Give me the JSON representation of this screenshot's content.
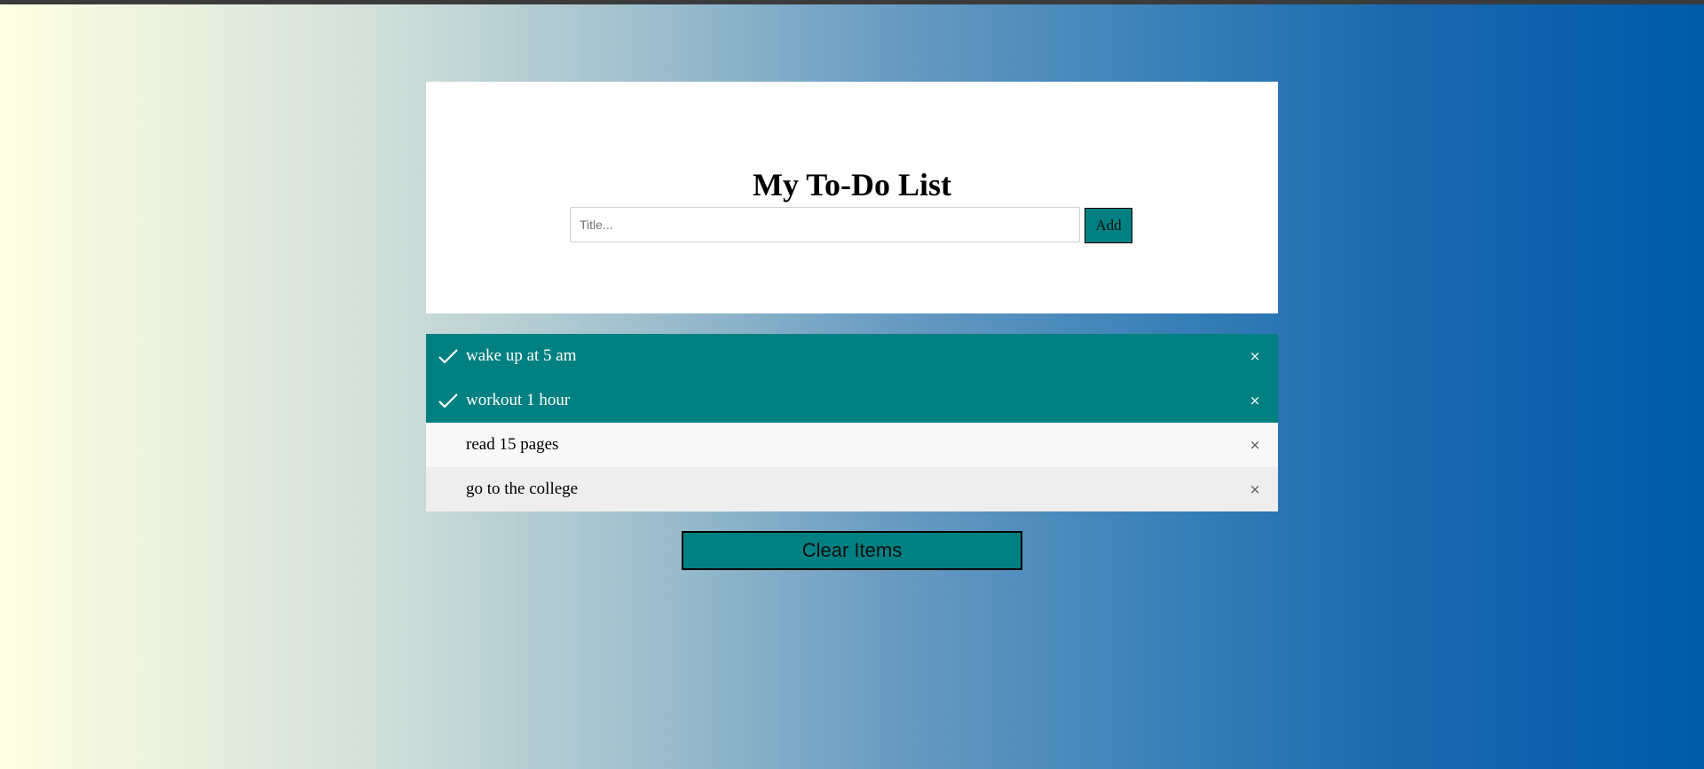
{
  "app": {
    "title": "My To-Do List"
  },
  "input": {
    "placeholder": "Title...",
    "value": ""
  },
  "add_button_label": "Add",
  "items": [
    {
      "label": "wake up at 5 am",
      "checked": true
    },
    {
      "label": "workout 1 hour",
      "checked": true
    },
    {
      "label": "read 15 pages",
      "checked": false
    },
    {
      "label": "go to the college",
      "checked": false
    }
  ],
  "close_glyph": "×",
  "clear_button_label": "Clear Items",
  "colors": {
    "accent": "#008080",
    "card": "#ffffff",
    "row_light": "#f8f8f8",
    "row_gray": "#eeeeee",
    "gradient_start": "#ffffe3",
    "gradient_end": "#005aa8"
  },
  "icons": {
    "check": "check-icon",
    "close": "close-icon"
  }
}
